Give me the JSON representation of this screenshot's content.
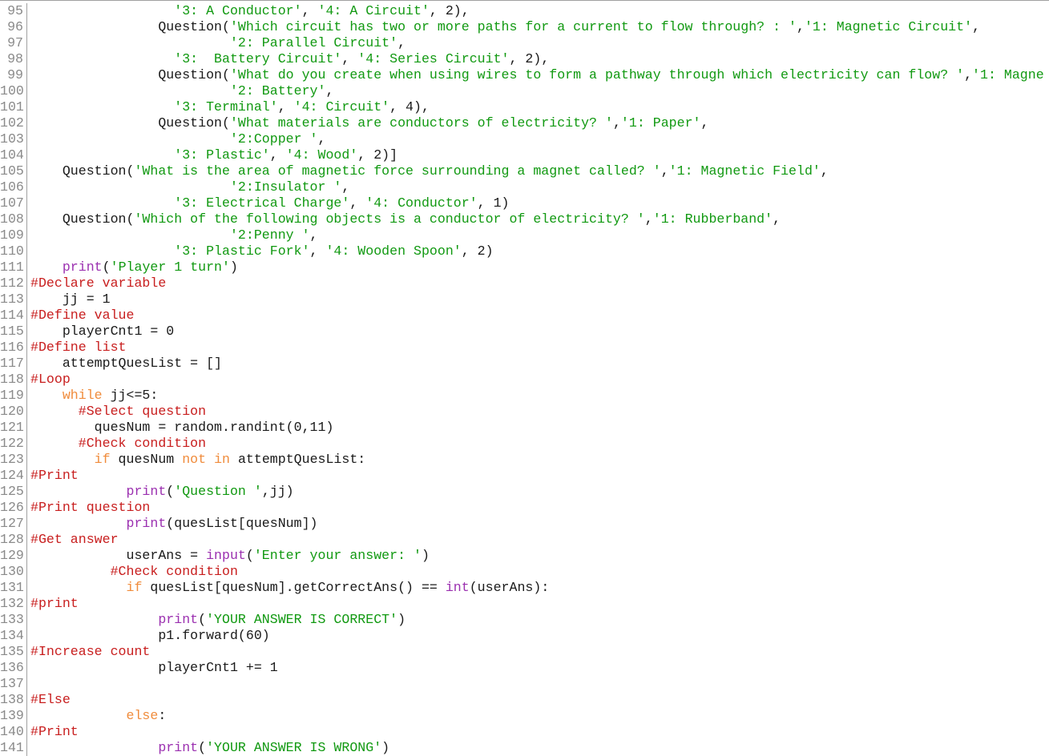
{
  "editor": {
    "first_line_number": 95,
    "lines": [
      {
        "n": "95",
        "tokens": [
          [
            "plain",
            "                  "
          ],
          [
            "str",
            "'3: A Conductor'"
          ],
          [
            "plain",
            ", "
          ],
          [
            "str",
            "'4: A Circuit'"
          ],
          [
            "plain",
            ", 2),"
          ]
        ]
      },
      {
        "n": "96",
        "tokens": [
          [
            "plain",
            "                Question("
          ],
          [
            "str",
            "'Which circuit has two or more paths for a current to flow through? : '"
          ],
          [
            "plain",
            ","
          ],
          [
            "str",
            "'1: Magnetic Circuit'"
          ],
          [
            "plain",
            ","
          ]
        ]
      },
      {
        "n": "97",
        "tokens": [
          [
            "plain",
            "                         "
          ],
          [
            "str",
            "'2: Parallel Circuit'"
          ],
          [
            "plain",
            ","
          ]
        ]
      },
      {
        "n": "98",
        "tokens": [
          [
            "plain",
            "                  "
          ],
          [
            "str",
            "'3:  Battery Circuit'"
          ],
          [
            "plain",
            ", "
          ],
          [
            "str",
            "'4: Series Circuit'"
          ],
          [
            "plain",
            ", 2),"
          ]
        ]
      },
      {
        "n": "99",
        "tokens": [
          [
            "plain",
            "                Question("
          ],
          [
            "str",
            "'What do you create when using wires to form a pathway through which electricity can flow? '"
          ],
          [
            "plain",
            ","
          ],
          [
            "str",
            "'1: Magne"
          ]
        ]
      },
      {
        "n": "100",
        "tokens": [
          [
            "plain",
            "                         "
          ],
          [
            "str",
            "'2: Battery'"
          ],
          [
            "plain",
            ","
          ]
        ]
      },
      {
        "n": "101",
        "tokens": [
          [
            "plain",
            "                  "
          ],
          [
            "str",
            "'3: Terminal'"
          ],
          [
            "plain",
            ", "
          ],
          [
            "str",
            "'4: Circuit'"
          ],
          [
            "plain",
            ", 4),"
          ]
        ]
      },
      {
        "n": "102",
        "tokens": [
          [
            "plain",
            "                Question("
          ],
          [
            "str",
            "'What materials are conductors of electricity? '"
          ],
          [
            "plain",
            ","
          ],
          [
            "str",
            "'1: Paper'"
          ],
          [
            "plain",
            ","
          ]
        ]
      },
      {
        "n": "103",
        "tokens": [
          [
            "plain",
            "                         "
          ],
          [
            "str",
            "'2:Copper '"
          ],
          [
            "plain",
            ","
          ]
        ]
      },
      {
        "n": "104",
        "tokens": [
          [
            "plain",
            "                  "
          ],
          [
            "str",
            "'3: Plastic'"
          ],
          [
            "plain",
            ", "
          ],
          [
            "str",
            "'4: Wood'"
          ],
          [
            "plain",
            ", 2)]"
          ]
        ]
      },
      {
        "n": "105",
        "tokens": [
          [
            "plain",
            "    Question("
          ],
          [
            "str",
            "'What is the area of magnetic force surrounding a magnet called? '"
          ],
          [
            "plain",
            ","
          ],
          [
            "str",
            "'1: Magnetic Field'"
          ],
          [
            "plain",
            ","
          ]
        ]
      },
      {
        "n": "106",
        "tokens": [
          [
            "plain",
            "                         "
          ],
          [
            "str",
            "'2:Insulator '"
          ],
          [
            "plain",
            ","
          ]
        ]
      },
      {
        "n": "107",
        "tokens": [
          [
            "plain",
            "                  "
          ],
          [
            "str",
            "'3: Electrical Charge'"
          ],
          [
            "plain",
            ", "
          ],
          [
            "str",
            "'4: Conductor'"
          ],
          [
            "plain",
            ", 1)"
          ]
        ]
      },
      {
        "n": "108",
        "tokens": [
          [
            "plain",
            "    Question("
          ],
          [
            "str",
            "'Which of the following objects is a conductor of electricity? '"
          ],
          [
            "plain",
            ","
          ],
          [
            "str",
            "'1: Rubberband'"
          ],
          [
            "plain",
            ","
          ]
        ]
      },
      {
        "n": "109",
        "tokens": [
          [
            "plain",
            "                         "
          ],
          [
            "str",
            "'2:Penny '"
          ],
          [
            "plain",
            ","
          ]
        ]
      },
      {
        "n": "110",
        "tokens": [
          [
            "plain",
            "                  "
          ],
          [
            "str",
            "'3: Plastic Fork'"
          ],
          [
            "plain",
            ", "
          ],
          [
            "str",
            "'4: Wooden Spoon'"
          ],
          [
            "plain",
            ", 2)"
          ]
        ]
      },
      {
        "n": "111",
        "tokens": [
          [
            "plain",
            "    "
          ],
          [
            "bi",
            "print"
          ],
          [
            "plain",
            "("
          ],
          [
            "str",
            "'Player 1 turn'"
          ],
          [
            "plain",
            ")"
          ]
        ]
      },
      {
        "n": "112",
        "tokens": [
          [
            "com",
            "#Declare variable"
          ]
        ]
      },
      {
        "n": "113",
        "tokens": [
          [
            "plain",
            "    jj = 1"
          ]
        ]
      },
      {
        "n": "114",
        "tokens": [
          [
            "com",
            "#Define value"
          ]
        ]
      },
      {
        "n": "115",
        "tokens": [
          [
            "plain",
            "    playerCnt1 = 0"
          ]
        ]
      },
      {
        "n": "116",
        "tokens": [
          [
            "com",
            "#Define list"
          ]
        ]
      },
      {
        "n": "117",
        "tokens": [
          [
            "plain",
            "    attemptQuesList = []"
          ]
        ]
      },
      {
        "n": "118",
        "tokens": [
          [
            "com",
            "#Loop"
          ]
        ]
      },
      {
        "n": "119",
        "tokens": [
          [
            "plain",
            "    "
          ],
          [
            "kw",
            "while"
          ],
          [
            "plain",
            " jj<=5:"
          ]
        ]
      },
      {
        "n": "120",
        "tokens": [
          [
            "plain",
            "      "
          ],
          [
            "com",
            "#Select question"
          ]
        ]
      },
      {
        "n": "121",
        "tokens": [
          [
            "plain",
            "        quesNum = random.randint(0,11)"
          ]
        ]
      },
      {
        "n": "122",
        "tokens": [
          [
            "plain",
            "      "
          ],
          [
            "com",
            "#Check condition"
          ]
        ]
      },
      {
        "n": "123",
        "tokens": [
          [
            "plain",
            "        "
          ],
          [
            "kw",
            "if"
          ],
          [
            "plain",
            " quesNum "
          ],
          [
            "kw",
            "not"
          ],
          [
            "plain",
            " "
          ],
          [
            "kw",
            "in"
          ],
          [
            "plain",
            " attemptQuesList:"
          ]
        ]
      },
      {
        "n": "124",
        "tokens": [
          [
            "com",
            "#Print"
          ]
        ]
      },
      {
        "n": "125",
        "tokens": [
          [
            "plain",
            "            "
          ],
          [
            "bi",
            "print"
          ],
          [
            "plain",
            "("
          ],
          [
            "str",
            "'Question '"
          ],
          [
            "plain",
            ",jj)"
          ]
        ]
      },
      {
        "n": "126",
        "tokens": [
          [
            "com",
            "#Print question"
          ]
        ]
      },
      {
        "n": "127",
        "tokens": [
          [
            "plain",
            "            "
          ],
          [
            "bi",
            "print"
          ],
          [
            "plain",
            "(quesList[quesNum])"
          ]
        ]
      },
      {
        "n": "128",
        "tokens": [
          [
            "com",
            "#Get answer"
          ]
        ]
      },
      {
        "n": "129",
        "tokens": [
          [
            "plain",
            "            userAns = "
          ],
          [
            "bi",
            "input"
          ],
          [
            "plain",
            "("
          ],
          [
            "str",
            "'Enter your answer: '"
          ],
          [
            "plain",
            ")"
          ]
        ]
      },
      {
        "n": "130",
        "tokens": [
          [
            "plain",
            "          "
          ],
          [
            "com",
            "#Check condition"
          ]
        ]
      },
      {
        "n": "131",
        "tokens": [
          [
            "plain",
            "            "
          ],
          [
            "kw",
            "if"
          ],
          [
            "plain",
            " quesList[quesNum].getCorrectAns() == "
          ],
          [
            "bi",
            "int"
          ],
          [
            "plain",
            "(userAns):"
          ]
        ]
      },
      {
        "n": "132",
        "tokens": [
          [
            "com",
            "#print"
          ]
        ]
      },
      {
        "n": "133",
        "tokens": [
          [
            "plain",
            "                "
          ],
          [
            "bi",
            "print"
          ],
          [
            "plain",
            "("
          ],
          [
            "str",
            "'YOUR ANSWER IS CORRECT'"
          ],
          [
            "plain",
            ")"
          ]
        ]
      },
      {
        "n": "134",
        "tokens": [
          [
            "plain",
            "                p1.forward(60)"
          ]
        ]
      },
      {
        "n": "135",
        "tokens": [
          [
            "com",
            "#Increase count"
          ]
        ]
      },
      {
        "n": "136",
        "tokens": [
          [
            "plain",
            "                playerCnt1 += 1"
          ]
        ]
      },
      {
        "n": "137",
        "tokens": []
      },
      {
        "n": "138",
        "tokens": [
          [
            "com",
            "#Else"
          ]
        ]
      },
      {
        "n": "139",
        "tokens": [
          [
            "plain",
            "            "
          ],
          [
            "kw",
            "else"
          ],
          [
            "plain",
            ":"
          ]
        ]
      },
      {
        "n": "140",
        "tokens": [
          [
            "com",
            "#Print"
          ]
        ]
      },
      {
        "n": "141",
        "tokens": [
          [
            "plain",
            "                "
          ],
          [
            "bi",
            "print"
          ],
          [
            "plain",
            "("
          ],
          [
            "str",
            "'YOUR ANSWER IS WRONG'"
          ],
          [
            "plain",
            ")"
          ]
        ]
      }
    ]
  },
  "colors": {
    "string": "#119911",
    "comment": "#c81e1e",
    "keyword": "#f08c3c",
    "builtin": "#9b30b0",
    "text": "#1a1a1a",
    "line_number": "#8a8a8a",
    "gutter_border": "#a0a0a0"
  }
}
